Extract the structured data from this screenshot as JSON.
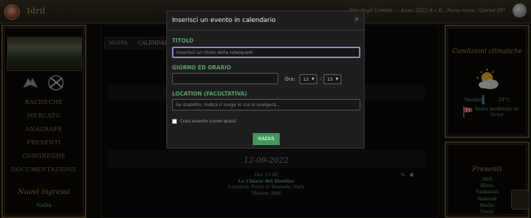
{
  "topbar": {
    "username": "Idril",
    "date_text": "Era degli Uomini — Anno 2022 d.c.B., Nono mese, Giorno 09°"
  },
  "left": {
    "menu": [
      "BACHECHE",
      "MERCATO",
      "ANAGRAFE",
      "PRESENTI",
      "CONGREGHE",
      "DOCUMENTAZIONE"
    ],
    "new_title": "Nuovi ingressi",
    "new_name": "Nailia"
  },
  "center": {
    "tabs": [
      "MAPPA",
      "CALENDARIO"
    ],
    "date_label": "12-09-2022",
    "event": {
      "time": "Ore 21:00",
      "title": "La Chiave del Destino",
      "location": "Location: Porto di Hanaele, Faro",
      "master": "Master: Idril"
    }
  },
  "right": {
    "weather_title": "Condizioni climatiche",
    "variable": "Variabile",
    "temp": "24°C",
    "wind": "Vento moderato da Ovest",
    "presenti_title": "Presenti",
    "presenti": [
      "Idril",
      "Klaus",
      "Nathaniel",
      "Radovid",
      "Rasha",
      "Sarus"
    ]
  },
  "modal": {
    "title": "Inserisci un evento in calendario",
    "close": "×",
    "titolo_label": "TITOLO",
    "titolo_placeholder": "Inserisci un titolo della role/quest",
    "giorno_label": "GIORNO ED ORARIO",
    "ora_label": "Ora:",
    "hour": "12",
    "minute": "15",
    "location_label": "LOCATION (FACOLTATIVA)",
    "location_placeholder": "Se stabilito, indica il luogo in cui si svolgerà...",
    "checkbox_label": "Crea evento come quest",
    "save_label": "SALVA"
  },
  "colors": {
    "accent_green": "#3f9a57",
    "label_green": "#57a06a",
    "gold": "#b28a3a"
  }
}
